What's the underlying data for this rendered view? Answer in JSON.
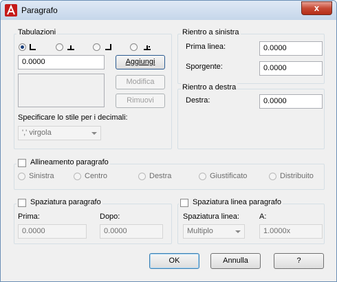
{
  "window": {
    "title": "Paragrafo",
    "close_label": "x"
  },
  "tabs": {
    "group_label": "Tabulazioni",
    "position_value": "0.0000",
    "add_label": "Aggiungi",
    "modify_label": "Modifica",
    "remove_label": "Rimuovi",
    "decimal_label": "Specificare lo stile per i decimali:",
    "decimal_value": "',' virgola"
  },
  "left_indent": {
    "group_label": "Rientro a sinistra",
    "first_line_label": "Prima linea:",
    "first_line_value": "0.0000",
    "hanging_label": "Sporgente:",
    "hanging_value": "0.0000"
  },
  "right_indent": {
    "group_label": "Rientro a destra",
    "right_label": "Destra:",
    "right_value": "0.0000"
  },
  "alignment": {
    "check_label": "Allineamento paragrafo",
    "options": [
      "Sinistra",
      "Centro",
      "Destra",
      "Giustificato",
      "Distribuito"
    ]
  },
  "para_spacing": {
    "check_label": "Spaziatura paragrafo",
    "before_label": "Prima:",
    "before_value": "0.0000",
    "after_label": "Dopo:",
    "after_value": "0.0000"
  },
  "line_spacing": {
    "check_label": "Spaziatura linea paragrafo",
    "spacing_label": "Spaziatura linea:",
    "spacing_value": "Multiplo",
    "at_label": "A:",
    "at_value": "1.0000x"
  },
  "buttons": {
    "ok": "OK",
    "cancel": "Annulla",
    "help": "?"
  }
}
